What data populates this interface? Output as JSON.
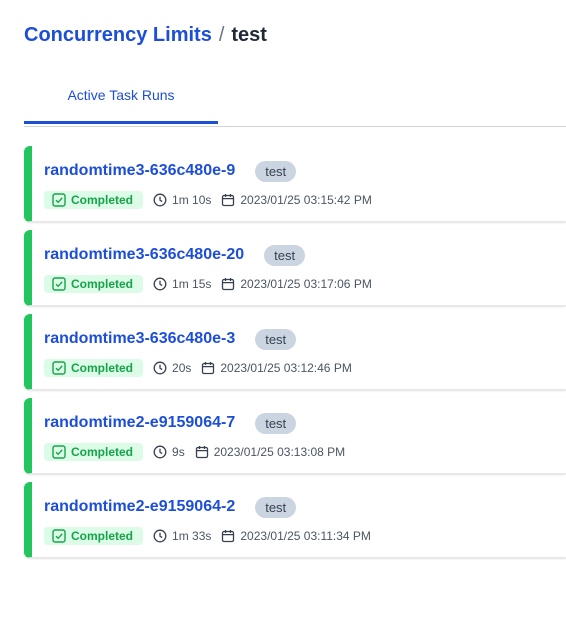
{
  "breadcrumb": {
    "parent": "Concurrency Limits",
    "separator": "/",
    "current": "test"
  },
  "tabs": [
    {
      "label": "Active Task Runs"
    }
  ],
  "runs": [
    {
      "name": "randomtime3-636c480e-9",
      "tag": "test",
      "state": "Completed",
      "duration": "1m 10s",
      "timestamp": "2023/01/25 03:15:42 PM"
    },
    {
      "name": "randomtime3-636c480e-20",
      "tag": "test",
      "state": "Completed",
      "duration": "1m 15s",
      "timestamp": "2023/01/25 03:17:06 PM"
    },
    {
      "name": "randomtime3-636c480e-3",
      "tag": "test",
      "state": "Completed",
      "duration": "20s",
      "timestamp": "2023/01/25 03:12:46 PM"
    },
    {
      "name": "randomtime2-e9159064-7",
      "tag": "test",
      "state": "Completed",
      "duration": "9s",
      "timestamp": "2023/01/25 03:13:08 PM"
    },
    {
      "name": "randomtime2-e9159064-2",
      "tag": "test",
      "state": "Completed",
      "duration": "1m 33s",
      "timestamp": "2023/01/25 03:11:34 PM"
    }
  ],
  "colors": {
    "accent": "#1d4ed8",
    "completed": "#22c55e",
    "completed_bg": "#dcfce7",
    "tag_bg": "#cbd5e1"
  },
  "icons": {
    "state": "check-square-icon",
    "duration": "clock-icon",
    "timestamp": "calendar-icon"
  }
}
